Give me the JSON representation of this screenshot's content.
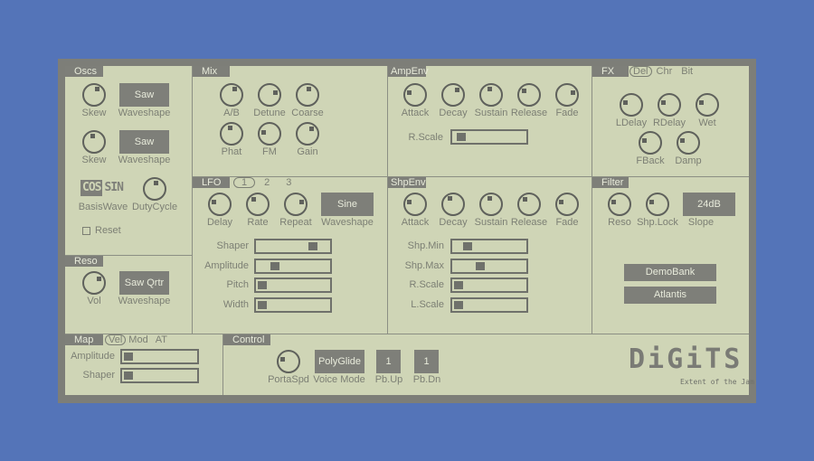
{
  "colors": {
    "background": "#5474b8",
    "panel": "#cfd5b6",
    "frame": "#7d7e78",
    "control": "#7e7f79",
    "text": "#7c7f74"
  },
  "oscs": {
    "title": "Oscs",
    "rows": [
      {
        "knob_label": "Skew",
        "knob_value": 0.6,
        "wave_value": "Saw",
        "wave_label": "Waveshape"
      },
      {
        "knob_label": "Skew",
        "knob_value": 0.45,
        "wave_value": "Saw",
        "wave_label": "Waveshape"
      }
    ],
    "basis": {
      "cos": "COS",
      "sin": "SIN",
      "selected": "COS",
      "label": "BasisWave"
    },
    "duty": {
      "label": "DutyCycle",
      "value": 0.55
    },
    "reset": {
      "label": "Reset",
      "checked": false
    }
  },
  "reso": {
    "title": "Reso",
    "vol": {
      "label": "Vol",
      "value": 0.7
    },
    "wave": {
      "value": "Saw Qrtr",
      "label": "Waveshape"
    }
  },
  "mix": {
    "title": "Mix",
    "knobs": [
      {
        "label": "A/B",
        "value": 0.6
      },
      {
        "label": "Detune",
        "value": 0.75
      },
      {
        "label": "Coarse",
        "value": 0.55
      },
      {
        "label": "Phat",
        "value": 0.45
      },
      {
        "label": "FM",
        "value": 0.2
      },
      {
        "label": "Gain",
        "value": 0.65
      }
    ]
  },
  "lfo": {
    "title": "LFO",
    "tabs": [
      "1",
      "2",
      "3"
    ],
    "selected_tab": "1",
    "knobs": [
      {
        "label": "Delay",
        "value": 0.25
      },
      {
        "label": "Rate",
        "value": 0.35
      },
      {
        "label": "Repeat",
        "value": 0.75
      }
    ],
    "wave": {
      "value": "Sine",
      "label": "Waveshape"
    },
    "sliders": [
      {
        "label": "Shaper",
        "value": 0.82
      },
      {
        "label": "Amplitude",
        "value": 0.2
      },
      {
        "label": "Pitch",
        "value": 0.0
      },
      {
        "label": "Width",
        "value": 0.0
      }
    ]
  },
  "ampenv": {
    "title": "AmpEnv",
    "knobs": [
      {
        "label": "Attack",
        "value": 0.25
      },
      {
        "label": "Decay",
        "value": 0.65
      },
      {
        "label": "Sustain",
        "value": 0.45
      },
      {
        "label": "Release",
        "value": 0.3
      },
      {
        "label": "Fade",
        "value": 0.75
      }
    ],
    "slider": {
      "label": "R.Scale",
      "value": 0.05
    }
  },
  "shpenv": {
    "title": "ShpEnv",
    "knobs": [
      {
        "label": "Attack",
        "value": 0.25
      },
      {
        "label": "Decay",
        "value": 0.4
      },
      {
        "label": "Sustain",
        "value": 0.45
      },
      {
        "label": "Release",
        "value": 0.35
      },
      {
        "label": "Fade",
        "value": 0.25
      }
    ],
    "sliders": [
      {
        "label": "Shp.Min",
        "value": 0.15
      },
      {
        "label": "Shp.Max",
        "value": 0.35
      },
      {
        "label": "R.Scale",
        "value": 0.0
      },
      {
        "label": "L.Scale",
        "value": 0.0
      }
    ]
  },
  "fx": {
    "title": "FX",
    "tabs": [
      "Del",
      "Chr",
      "Bit"
    ],
    "selected_tab": "Del",
    "knobs": [
      {
        "label": "LDelay",
        "value": 0.25
      },
      {
        "label": "RDelay",
        "value": 0.25
      },
      {
        "label": "Wet",
        "value": 0.25
      },
      {
        "label": "FBack",
        "value": 0.25
      },
      {
        "label": "Damp",
        "value": 0.25
      }
    ]
  },
  "filter": {
    "title": "Filter",
    "knobs": [
      {
        "label": "Reso",
        "value": 0.25
      },
      {
        "label": "Shp.Lock",
        "value": 0.25
      }
    ],
    "slope": {
      "value": "24dB",
      "label": "Slope"
    },
    "bank": "DemoBank",
    "preset": "Atlantis"
  },
  "map": {
    "title": "Map",
    "tabs": [
      "Vel",
      "Mod",
      "AT"
    ],
    "selected_tab": "Vel",
    "sliders": [
      {
        "label": "Amplitude",
        "value": 0.0
      },
      {
        "label": "Shaper",
        "value": 0.0
      }
    ]
  },
  "control": {
    "title": "Control",
    "porta": {
      "label": "PortaSpd",
      "value": 0.25
    },
    "voice_mode": {
      "value": "PolyGlide",
      "label": "Voice Mode"
    },
    "pb_up": {
      "value": "1",
      "label": "Pb.Up"
    },
    "pb_dn": {
      "value": "1",
      "label": "Pb.Dn"
    }
  },
  "branding": {
    "logo": "DiGiTS",
    "tagline": "Extent of the Jam"
  }
}
